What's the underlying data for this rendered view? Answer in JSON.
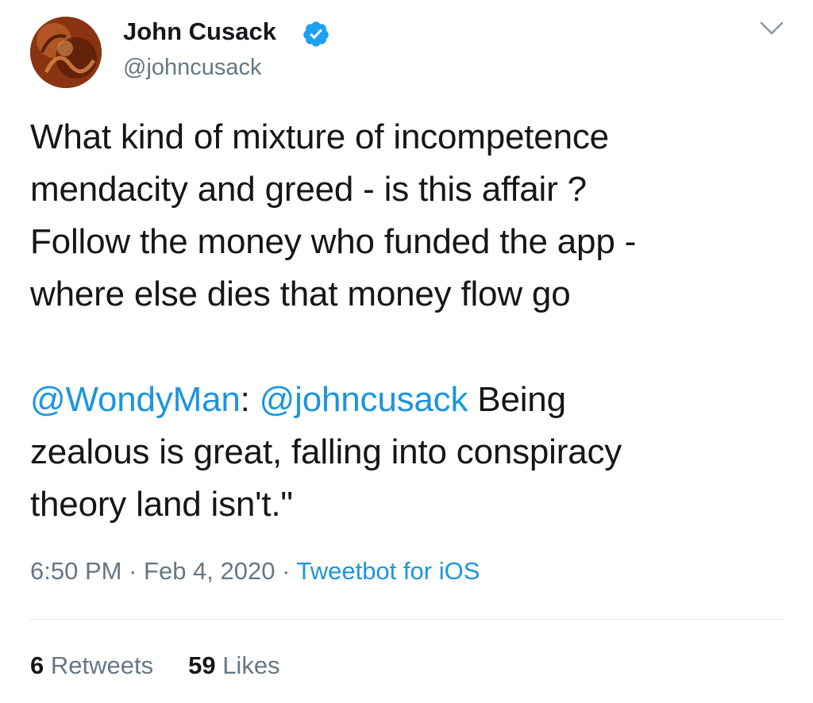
{
  "author": {
    "display_name": "John Cusack",
    "handle": "@johncusack",
    "verified": true
  },
  "tweet": {
    "line_1": "What kind of mixture of incompetence",
    "line_2": "mendacity and greed - is this affair ?",
    "line_3": "Follow the money who funded the app -",
    "line_4": "where else dies that money flow go",
    "quote_mention_1": "@WondyMan",
    "quote_colon": ": ",
    "quote_mention_2": "@johncusack",
    "quote_line_1_rest": " Being",
    "quote_line_2": "zealous is great,  falling into conspiracy",
    "quote_line_3": "theory land isn't.\""
  },
  "meta": {
    "time": "6:50 PM",
    "separator_1": " · ",
    "date": "Feb 4, 2020",
    "separator_2": " · ",
    "source": "Tweetbot for iOS"
  },
  "stats": {
    "retweets_count": "6",
    "retweets_label": " Retweets",
    "likes_count": "59",
    "likes_label": " Likes"
  },
  "icons": {
    "verified": "verified-badge-icon",
    "menu": "chevron-down-icon"
  },
  "colors": {
    "link": "#1b95e0",
    "secondary_text": "#657786",
    "primary_text": "#14171a",
    "verified_badge": "#1da1f2"
  }
}
